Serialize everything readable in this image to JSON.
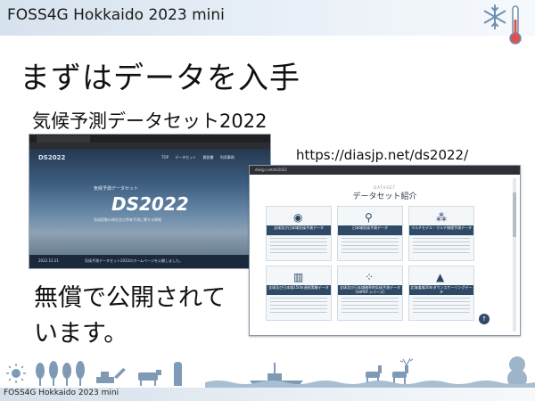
{
  "header": {
    "title": "FOSS4G Hokkaido 2023 mini"
  },
  "slide": {
    "title": "まずはデータを入手",
    "subtitle": "気候予測データセット2022",
    "url": "https://diasjp.net/ds2022/",
    "note": "無償で公開されています。"
  },
  "site_top": {
    "brand": "DS2022",
    "nav": [
      "TOP",
      "データセット",
      "解説書",
      "利用事例"
    ],
    "hero_tag": "気候予測データセット",
    "hero_title": "DS2022",
    "hero_desc": "気候変動の現在及び将来予測に関する情報",
    "news_date": "2022.12.21",
    "news_text": "気候予測データセット2022のホームページを公開しました。"
  },
  "site_datasets": {
    "address": "diasjp.net/ds2022",
    "kicker": "DATASET",
    "heading": "データセット紹介",
    "cards": [
      {
        "icon": "globe-icon",
        "label": "全球及び日本域気候予測データ"
      },
      {
        "icon": "japan-map-icon",
        "label": "日本域気候予測データ"
      },
      {
        "icon": "network-icon",
        "label": "マルチモデル・マルチ物理予測データ"
      },
      {
        "icon": "bar-chart-icon",
        "label": "全球及び日本域150年連続実験データ"
      },
      {
        "icon": "scatter-icon",
        "label": "全球及び日本域確率的気候予測データ（d4PDF シリーズ）"
      },
      {
        "icon": "factory-icon",
        "label": "北海道域20年ダウンスケーリングデータ"
      }
    ],
    "back_to_top": "↑"
  },
  "footer": {
    "text": "FOSS4G Hokkaido 2023 mini"
  },
  "colors": {
    "accent": "#2e4a66",
    "header_bg": "#d6e2ee",
    "silhouette": "#7e9ab5"
  }
}
